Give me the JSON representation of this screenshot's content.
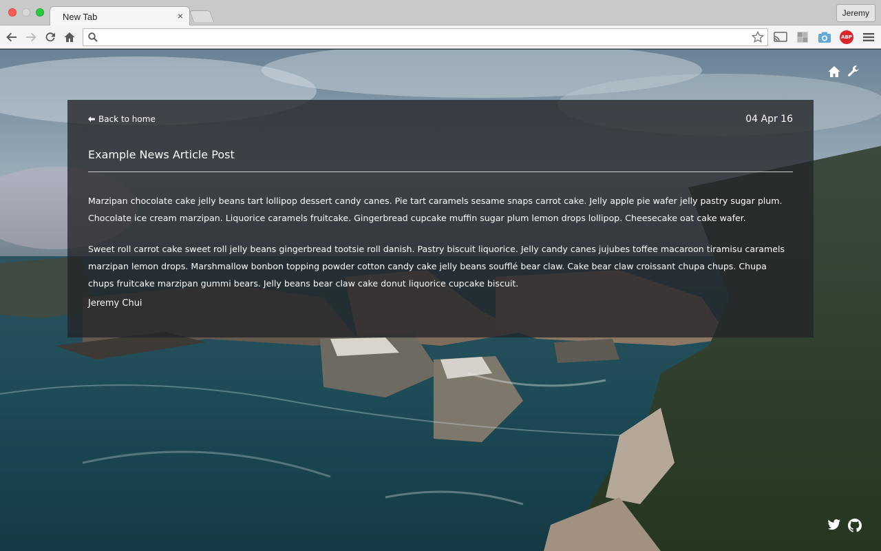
{
  "browser": {
    "tab_title": "New Tab",
    "tab_close": "×",
    "profile_name": "Jeremy",
    "omnibox_value": "",
    "extensions": [
      "cast-icon",
      "tiles-icon",
      "camera-icon",
      "adblock-plus-icon",
      "menu-icon"
    ],
    "abp_label": "ABP"
  },
  "page": {
    "back_label": "Back to home",
    "date": "04 Apr 16",
    "title": "Example News Article Post",
    "paragraphs": [
      "Marzipan chocolate cake jelly beans tart lollipop dessert candy canes. Pie tart caramels sesame snaps carrot cake. Jelly apple pie wafer jelly pastry sugar plum. Chocolate ice cream marzipan. Liquorice caramels fruitcake. Gingerbread cupcake muffin sugar plum lemon drops lollipop. Cheesecake oat cake wafer.",
      "Sweet roll carrot cake sweet roll jelly beans gingerbread tootsie roll danish. Pastry biscuit liquorice. Jelly candy canes jujubes toffee macaroon tiramisu caramels marzipan lemon drops. Marshmallow bonbon topping powder cotton candy cake jelly beans soufflé bear claw. Cake bear claw croissant chupa chups. Chupa chups fruitcake marzipan gummi bears. Jelly beans bear claw cake donut liquorice cupcake biscuit."
    ],
    "author": "Jeremy Chui"
  },
  "colors": {
    "traffic_red": "#fc5f57",
    "traffic_green": "#2ac940",
    "abp_red": "#d8262c",
    "panel_bg": "rgba(35,36,40,0.78)"
  }
}
